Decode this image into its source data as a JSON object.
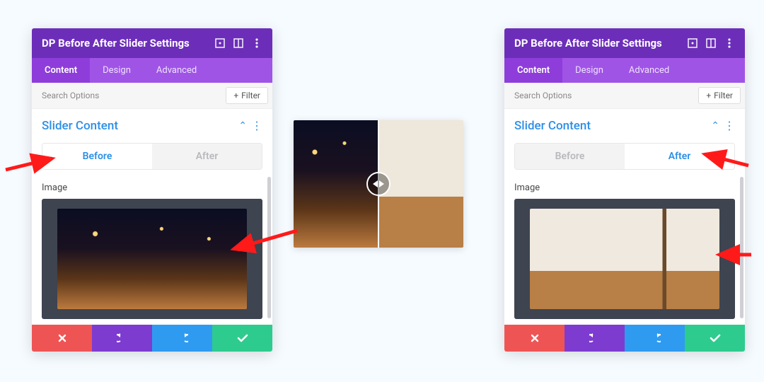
{
  "header": {
    "title": "DP Before After Slider Settings"
  },
  "tabs": [
    "Content",
    "Design",
    "Advanced"
  ],
  "search": {
    "placeholder": "Search Options",
    "filter_label": "Filter"
  },
  "section": {
    "title": "Slider Content"
  },
  "inner_tabs": {
    "before": "Before",
    "after": "After"
  },
  "field": {
    "image_label": "Image"
  }
}
